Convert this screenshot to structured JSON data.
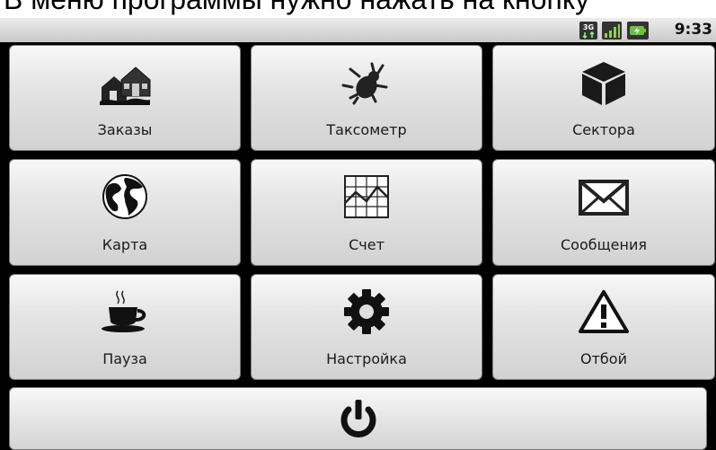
{
  "caption": "В меню программы нужно нажать на кнопку",
  "status_bar": {
    "time": "9:33",
    "icons": [
      "network-3g-icon",
      "signal-icon",
      "battery-icon"
    ]
  },
  "menu": {
    "buttons": [
      {
        "label": "Заказы",
        "icon": "houses-icon"
      },
      {
        "label": "Таксометр",
        "icon": "beetle-icon"
      },
      {
        "label": "Сектора",
        "icon": "cube-icon"
      },
      {
        "label": "Карта",
        "icon": "globe-icon"
      },
      {
        "label": "Счет",
        "icon": "chart-icon"
      },
      {
        "label": "Сообщения",
        "icon": "envelope-icon"
      },
      {
        "label": "Пауза",
        "icon": "coffee-cup-icon"
      },
      {
        "label": "Настройка",
        "icon": "gear-icon"
      },
      {
        "label": "Отбой",
        "icon": "warning-icon"
      }
    ],
    "power_button": {
      "icon": "power-icon"
    }
  }
}
